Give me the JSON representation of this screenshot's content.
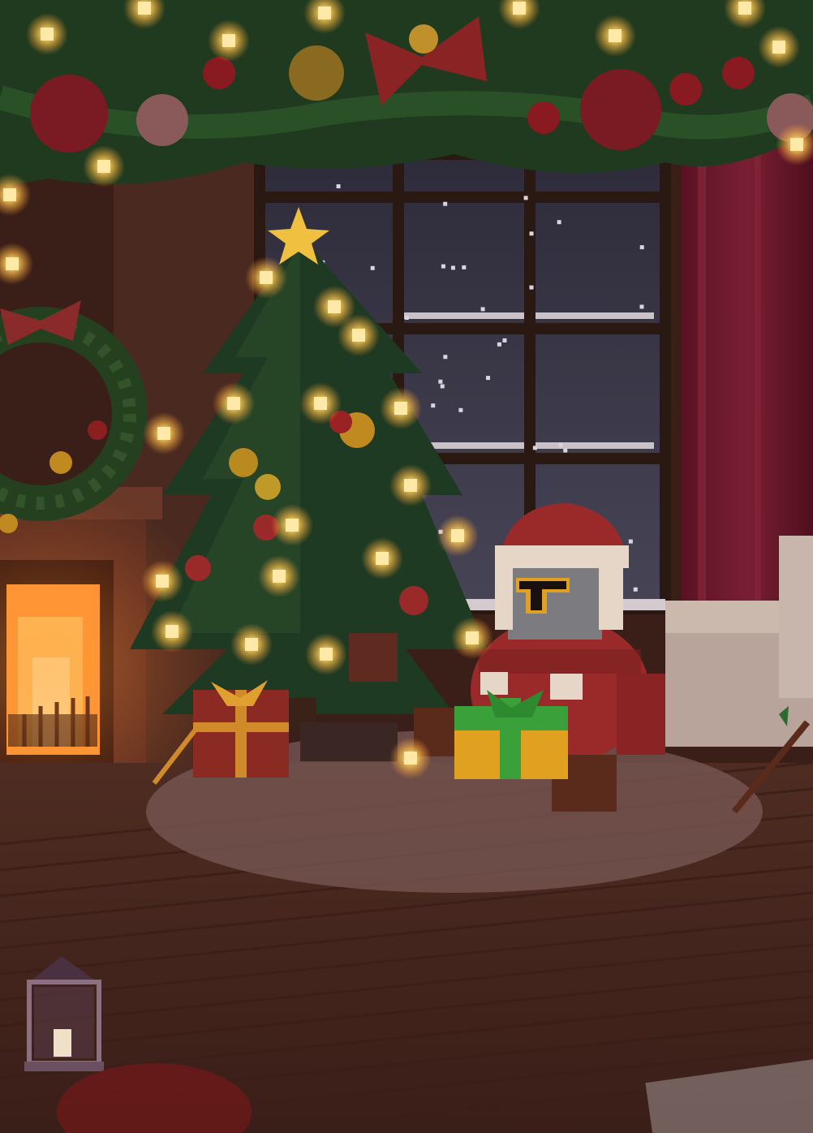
{
  "scene": {
    "subject": "santa-knight",
    "elements": [
      "garland",
      "window",
      "curtain",
      "fireplace",
      "wreath",
      "christmas-tree",
      "presents",
      "rug",
      "lantern",
      "sofa",
      "cane"
    ],
    "snow": true,
    "lights_on": true
  },
  "palette": {
    "wall": "#3a1f18",
    "brick": "#4a2a20",
    "floor": "#4b2a20",
    "floor_light": "#6a3a2a",
    "night_sky": "#3a3846",
    "window_frame": "#2a1812",
    "curtain": "#6e1a2c",
    "garland": "#1f3a1e",
    "light": "#ffd77a",
    "fire": "#ffb347",
    "santa_red": "#9a2a2a",
    "fur": "#e6d6c8",
    "gift_green": "#3aa03a",
    "gift_gold": "#e0a020",
    "rug": "#7a5a55"
  }
}
